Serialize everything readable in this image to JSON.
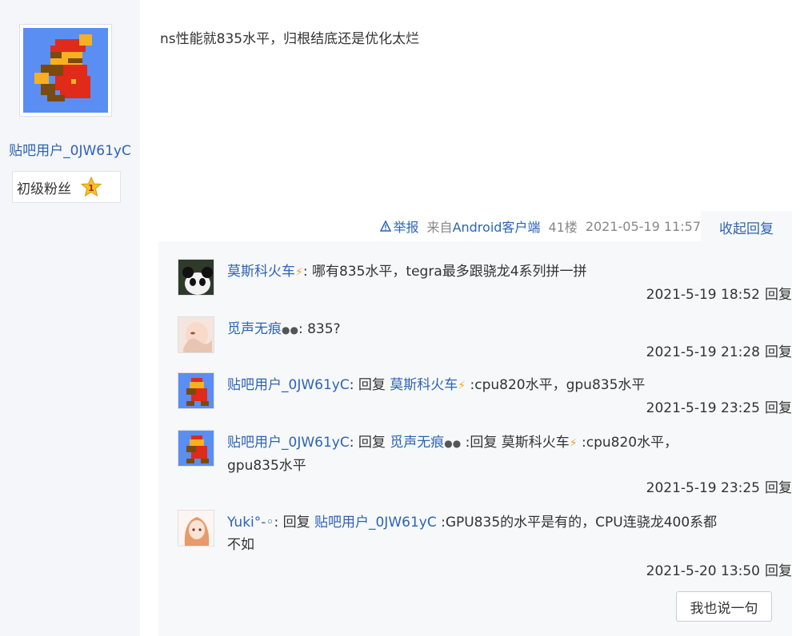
{
  "author": {
    "username": "贴吧用户_0JW61yC",
    "badge": "初级粉丝",
    "badge_level": "1"
  },
  "post": {
    "content": "ns性能就835水平，归根结底还是优化太烂"
  },
  "post_tail": {
    "report": "举报",
    "from_prefix": "来自",
    "client": "Android客户端",
    "floor": "41楼",
    "datetime": "2021-05-19 11:57",
    "collapse": "收起回复"
  },
  "comments": [
    {
      "user": "莫斯科火车",
      "text": ": 哪有835水平，tegra最多跟骁龙4系列拼一拼",
      "time": "2021-5-19 18:52",
      "reply": "回复"
    },
    {
      "user": "觅声无痕",
      "text": ": 835?",
      "time": "2021-5-19 21:28",
      "reply": "回复"
    },
    {
      "user": "贴吧用户_0JW61yC",
      "text_pre": ": 回复 ",
      "reply_to": "莫斯科火车",
      "text_post": " :cpu820水平，gpu835水平",
      "time": "2021-5-19 23:25",
      "reply": "回复"
    },
    {
      "user": "贴吧用户_0JW61yC",
      "text_pre": ": 回复 ",
      "reply_to": "觅声无痕",
      "text_post": " :回复 莫斯科火车",
      "text_post2": " :cpu820水平，gpu835水平",
      "time": "2021-5-19 23:25",
      "reply": "回复"
    },
    {
      "user": "Yuki°-◦",
      "text_pre": ": 回复 ",
      "reply_to": "贴吧用户_0JW61yC",
      "text_post": " :GPU835的水平是有的，CPU连骁龙400系都不如",
      "time": "2021-5-20 13:50",
      "reply": "回复"
    }
  ],
  "say_button": "我也说一句"
}
